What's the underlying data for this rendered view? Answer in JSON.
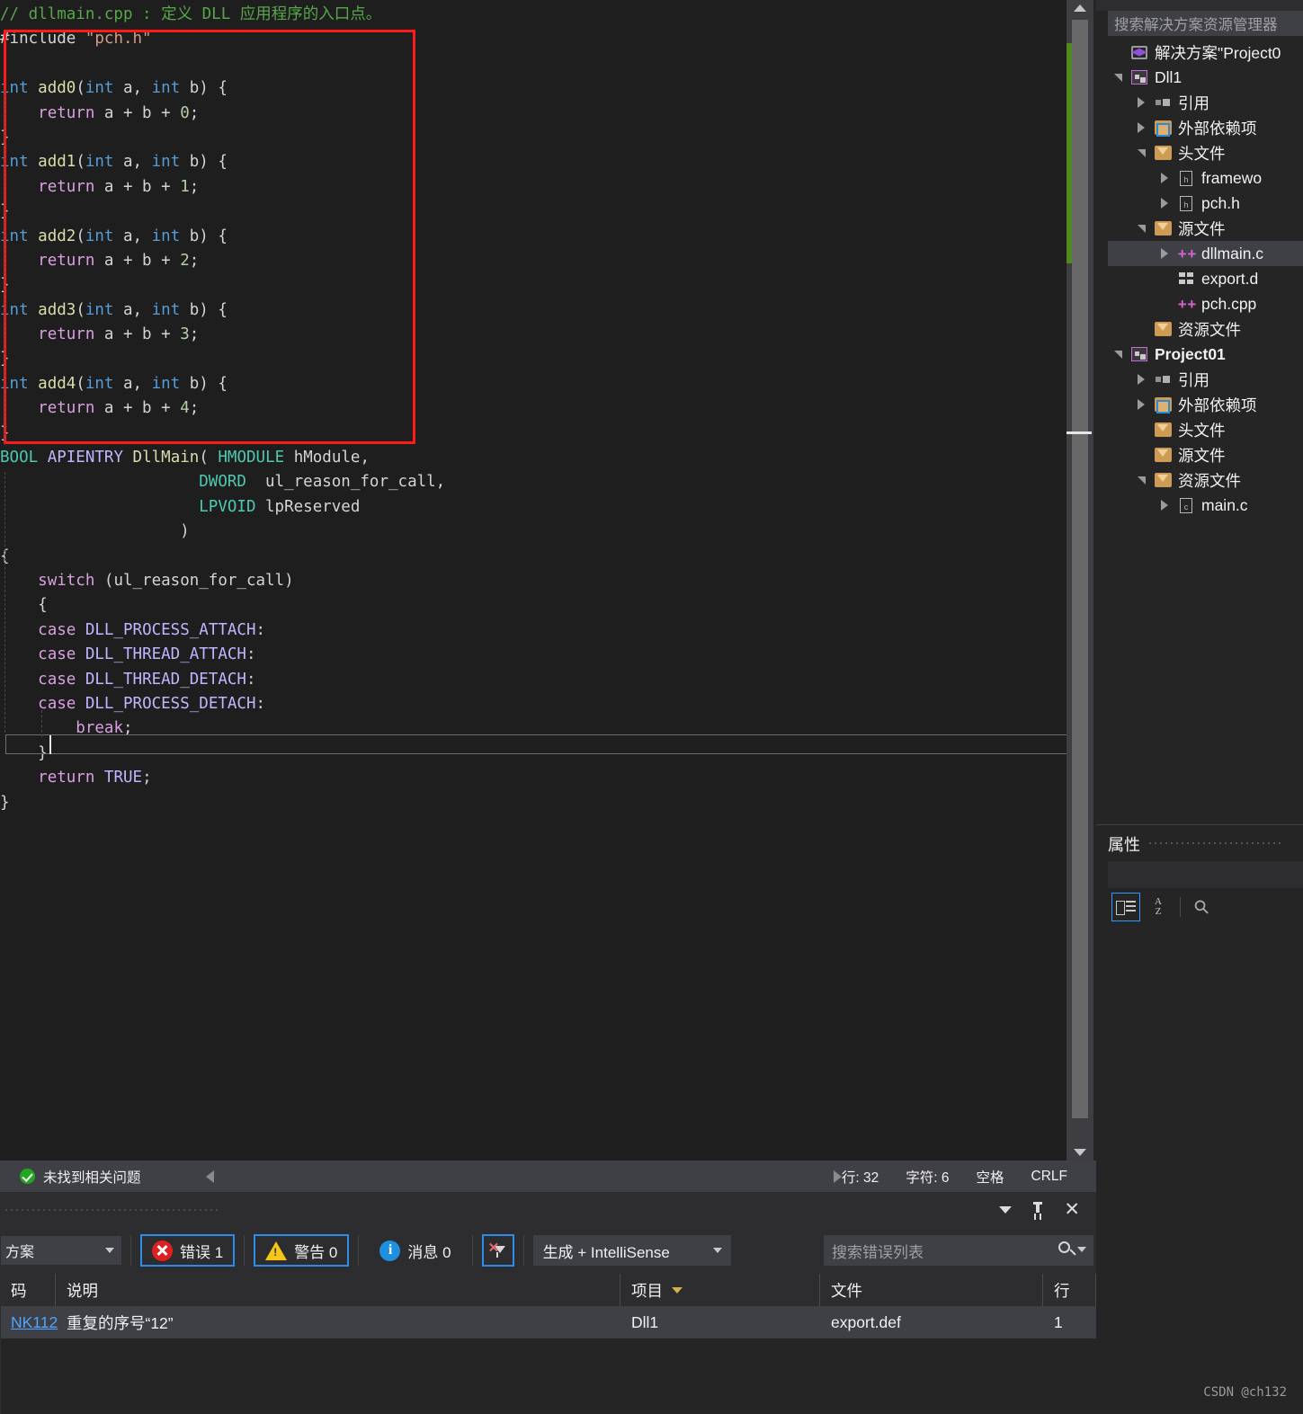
{
  "editor": {
    "filename": "dllmain.cpp",
    "code_lines": [
      {
        "tokens": [
          {
            "t": "// dllmain.cpp : 定义 DLL 应用程序的入口点。",
            "c": "cmt"
          }
        ]
      },
      {
        "tokens": [
          {
            "t": "#include",
            "c": "pp"
          },
          {
            "t": " ",
            "c": "pun"
          },
          {
            "t": "\"pch.h\"",
            "c": "str"
          }
        ]
      },
      {
        "tokens": []
      },
      {
        "tokens": [
          {
            "t": "int",
            "c": "kw"
          },
          {
            "t": " ",
            "c": "pun"
          },
          {
            "t": "add0",
            "c": "fn"
          },
          {
            "t": "(",
            "c": "pun"
          },
          {
            "t": "int",
            "c": "kw"
          },
          {
            "t": " a, ",
            "c": "id"
          },
          {
            "t": "int",
            "c": "kw"
          },
          {
            "t": " b) {",
            "c": "id"
          }
        ]
      },
      {
        "tokens": [
          {
            "t": "    ",
            "c": "pun"
          },
          {
            "t": "return",
            "c": "kwp"
          },
          {
            "t": " a + b + ",
            "c": "id"
          },
          {
            "t": "0",
            "c": "num"
          },
          {
            "t": ";",
            "c": "id"
          }
        ]
      },
      {
        "tokens": [
          {
            "t": "}",
            "c": "id"
          }
        ]
      },
      {
        "tokens": [
          {
            "t": "int",
            "c": "kw"
          },
          {
            "t": " ",
            "c": "pun"
          },
          {
            "t": "add1",
            "c": "fn"
          },
          {
            "t": "(",
            "c": "pun"
          },
          {
            "t": "int",
            "c": "kw"
          },
          {
            "t": " a, ",
            "c": "id"
          },
          {
            "t": "int",
            "c": "kw"
          },
          {
            "t": " b) {",
            "c": "id"
          }
        ]
      },
      {
        "tokens": [
          {
            "t": "    ",
            "c": "pun"
          },
          {
            "t": "return",
            "c": "kwp"
          },
          {
            "t": " a + b + ",
            "c": "id"
          },
          {
            "t": "1",
            "c": "num"
          },
          {
            "t": ";",
            "c": "id"
          }
        ]
      },
      {
        "tokens": [
          {
            "t": "}",
            "c": "id"
          }
        ]
      },
      {
        "tokens": [
          {
            "t": "int",
            "c": "kw"
          },
          {
            "t": " ",
            "c": "pun"
          },
          {
            "t": "add2",
            "c": "fn"
          },
          {
            "t": "(",
            "c": "pun"
          },
          {
            "t": "int",
            "c": "kw"
          },
          {
            "t": " a, ",
            "c": "id"
          },
          {
            "t": "int",
            "c": "kw"
          },
          {
            "t": " b) {",
            "c": "id"
          }
        ]
      },
      {
        "tokens": [
          {
            "t": "    ",
            "c": "pun"
          },
          {
            "t": "return",
            "c": "kwp"
          },
          {
            "t": " a + b + ",
            "c": "id"
          },
          {
            "t": "2",
            "c": "num"
          },
          {
            "t": ";",
            "c": "id"
          }
        ]
      },
      {
        "tokens": [
          {
            "t": "}",
            "c": "id"
          }
        ]
      },
      {
        "tokens": [
          {
            "t": "int",
            "c": "kw"
          },
          {
            "t": " ",
            "c": "pun"
          },
          {
            "t": "add3",
            "c": "fn"
          },
          {
            "t": "(",
            "c": "pun"
          },
          {
            "t": "int",
            "c": "kw"
          },
          {
            "t": " a, ",
            "c": "id"
          },
          {
            "t": "int",
            "c": "kw"
          },
          {
            "t": " b) {",
            "c": "id"
          }
        ]
      },
      {
        "tokens": [
          {
            "t": "    ",
            "c": "pun"
          },
          {
            "t": "return",
            "c": "kwp"
          },
          {
            "t": " a + b + ",
            "c": "id"
          },
          {
            "t": "3",
            "c": "num"
          },
          {
            "t": ";",
            "c": "id"
          }
        ]
      },
      {
        "tokens": [
          {
            "t": "}",
            "c": "id"
          }
        ]
      },
      {
        "tokens": [
          {
            "t": "int",
            "c": "kw"
          },
          {
            "t": " ",
            "c": "pun"
          },
          {
            "t": "add4",
            "c": "fn"
          },
          {
            "t": "(",
            "c": "pun"
          },
          {
            "t": "int",
            "c": "kw"
          },
          {
            "t": " a, ",
            "c": "id"
          },
          {
            "t": "int",
            "c": "kw"
          },
          {
            "t": " b) {",
            "c": "id"
          }
        ]
      },
      {
        "tokens": [
          {
            "t": "    ",
            "c": "pun"
          },
          {
            "t": "return",
            "c": "kwp"
          },
          {
            "t": " a + b + ",
            "c": "id"
          },
          {
            "t": "4",
            "c": "num"
          },
          {
            "t": ";",
            "c": "id"
          }
        ]
      },
      {
        "tokens": [
          {
            "t": "}",
            "c": "id"
          }
        ]
      },
      {
        "tokens": [
          {
            "t": "BOOL",
            "c": "typ"
          },
          {
            "t": " ",
            "c": "pun"
          },
          {
            "t": "APIENTRY",
            "c": "mac"
          },
          {
            "t": " ",
            "c": "pun"
          },
          {
            "t": "DllMain",
            "c": "fn"
          },
          {
            "t": "( ",
            "c": "pun"
          },
          {
            "t": "HMODULE",
            "c": "typ"
          },
          {
            "t": " hModule,",
            "c": "id"
          }
        ]
      },
      {
        "tokens": [
          {
            "t": "                     ",
            "c": "pun"
          },
          {
            "t": "DWORD",
            "c": "typ"
          },
          {
            "t": "  ul_reason_for_call,",
            "c": "id"
          }
        ]
      },
      {
        "tokens": [
          {
            "t": "                     ",
            "c": "pun"
          },
          {
            "t": "LPVOID",
            "c": "typ"
          },
          {
            "t": " lpReserved",
            "c": "id"
          }
        ]
      },
      {
        "tokens": [
          {
            "t": "                   )",
            "c": "id"
          }
        ]
      },
      {
        "tokens": [
          {
            "t": "{",
            "c": "id"
          }
        ]
      },
      {
        "tokens": [
          {
            "t": "    ",
            "c": "pun"
          },
          {
            "t": "switch",
            "c": "kwp"
          },
          {
            "t": " (ul_reason_for_call)",
            "c": "id"
          }
        ]
      },
      {
        "tokens": [
          {
            "t": "    {",
            "c": "id"
          }
        ]
      },
      {
        "tokens": [
          {
            "t": "    ",
            "c": "pun"
          },
          {
            "t": "case",
            "c": "kwp"
          },
          {
            "t": " ",
            "c": "pun"
          },
          {
            "t": "DLL_PROCESS_ATTACH",
            "c": "mac"
          },
          {
            "t": ":",
            "c": "id"
          }
        ]
      },
      {
        "tokens": [
          {
            "t": "    ",
            "c": "pun"
          },
          {
            "t": "case",
            "c": "kwp"
          },
          {
            "t": " ",
            "c": "pun"
          },
          {
            "t": "DLL_THREAD_ATTACH",
            "c": "mac"
          },
          {
            "t": ":",
            "c": "id"
          }
        ]
      },
      {
        "tokens": [
          {
            "t": "    ",
            "c": "pun"
          },
          {
            "t": "case",
            "c": "kwp"
          },
          {
            "t": " ",
            "c": "pun"
          },
          {
            "t": "DLL_THREAD_DETACH",
            "c": "mac"
          },
          {
            "t": ":",
            "c": "id"
          }
        ]
      },
      {
        "tokens": [
          {
            "t": "    ",
            "c": "pun"
          },
          {
            "t": "case",
            "c": "kwp"
          },
          {
            "t": " ",
            "c": "pun"
          },
          {
            "t": "DLL_PROCESS_DETACH",
            "c": "mac"
          },
          {
            "t": ":",
            "c": "id"
          }
        ]
      },
      {
        "tokens": [
          {
            "t": "        ",
            "c": "pun"
          },
          {
            "t": "break",
            "c": "kwp"
          },
          {
            "t": ";",
            "c": "id"
          }
        ]
      },
      {
        "tokens": [
          {
            "t": "    }",
            "c": "id"
          }
        ]
      },
      {
        "tokens": [
          {
            "t": "    ",
            "c": "pun"
          },
          {
            "t": "return",
            "c": "kwp"
          },
          {
            "t": " ",
            "c": "pun"
          },
          {
            "t": "TRUE",
            "c": "mac"
          },
          {
            "t": ";",
            "c": "id"
          }
        ]
      },
      {
        "tokens": [
          {
            "t": "}",
            "c": "id"
          }
        ]
      }
    ]
  },
  "status_bar": {
    "message": "未找到相关问题",
    "line_label": "行: 32",
    "char_label": "字符: 6",
    "indent_label": "空格",
    "eol_label": "CRLF"
  },
  "solution_explorer": {
    "search_placeholder": "搜索解决方案资源管理器",
    "tree": [
      {
        "label": "解决方案\"Project0",
        "icon": "solution-icon",
        "depth": 0,
        "expander": "none",
        "bold": false,
        "selected": false
      },
      {
        "label": "Dll1",
        "icon": "project-icon",
        "depth": 0,
        "expander": "down",
        "bold": false,
        "selected": false
      },
      {
        "label": "引用",
        "icon": "references-icon",
        "depth": 1,
        "expander": "right",
        "bold": false,
        "selected": false
      },
      {
        "label": "外部依赖项",
        "icon": "external-deps-icon",
        "depth": 1,
        "expander": "right",
        "bold": false,
        "selected": false
      },
      {
        "label": "头文件",
        "icon": "filter-folder-icon",
        "depth": 1,
        "expander": "down",
        "bold": false,
        "selected": false
      },
      {
        "label": "framewo",
        "icon": "header-file-icon",
        "depth": 2,
        "expander": "right",
        "bold": false,
        "selected": false
      },
      {
        "label": "pch.h",
        "icon": "header-file-icon",
        "depth": 2,
        "expander": "right",
        "bold": false,
        "selected": false
      },
      {
        "label": "源文件",
        "icon": "filter-folder-icon",
        "depth": 1,
        "expander": "down",
        "bold": false,
        "selected": false
      },
      {
        "label": "dllmain.c",
        "icon": "cpp-file-icon",
        "depth": 2,
        "expander": "right",
        "bold": false,
        "selected": true
      },
      {
        "label": "export.d",
        "icon": "def-file-icon",
        "depth": 2,
        "expander": "none",
        "bold": false,
        "selected": false
      },
      {
        "label": "pch.cpp",
        "icon": "cpp-file-icon",
        "depth": 2,
        "expander": "none",
        "bold": false,
        "selected": false
      },
      {
        "label": "资源文件",
        "icon": "filter-folder-icon",
        "depth": 1,
        "expander": "none",
        "bold": false,
        "selected": false
      },
      {
        "label": "Project01",
        "icon": "project-icon",
        "depth": 0,
        "expander": "down",
        "bold": true,
        "selected": false
      },
      {
        "label": "引用",
        "icon": "references-icon",
        "depth": 1,
        "expander": "right",
        "bold": false,
        "selected": false
      },
      {
        "label": "外部依赖项",
        "icon": "external-deps-icon",
        "depth": 1,
        "expander": "right",
        "bold": false,
        "selected": false
      },
      {
        "label": "头文件",
        "icon": "filter-folder-icon",
        "depth": 1,
        "expander": "none",
        "bold": false,
        "selected": false
      },
      {
        "label": "源文件",
        "icon": "filter-folder-icon",
        "depth": 1,
        "expander": "none",
        "bold": false,
        "selected": false
      },
      {
        "label": "资源文件",
        "icon": "filter-folder-icon",
        "depth": 1,
        "expander": "down",
        "bold": false,
        "selected": false
      },
      {
        "label": "main.c",
        "icon": "c-file-icon",
        "depth": 2,
        "expander": "right",
        "bold": false,
        "selected": false
      }
    ]
  },
  "properties_panel": {
    "title": "属性",
    "buttons": [
      "categorized-icon",
      "alphabetical-icon",
      "property-pages-icon"
    ]
  },
  "error_list": {
    "scope_value": "方案",
    "errors_label": "错误 1",
    "warnings_label": "警告 0",
    "messages_label": "消息 0",
    "build_filter_value": "生成 + IntelliSense",
    "search_placeholder": "搜索错误列表",
    "columns": [
      "码",
      "说明",
      "项目",
      "文件",
      "行"
    ],
    "rows": [
      {
        "code": "NK112",
        "description": "重复的序号“12”",
        "project": "Dll1",
        "file": "export.def",
        "line": "1"
      }
    ]
  },
  "watermark": "CSDN @ch132",
  "colors": {
    "accent_blue": "#2d8ceb",
    "error_red": "#e02020",
    "warning_yellow": "#f5c518",
    "info_blue": "#1f8fe0",
    "annotation_red": "#ff1a1a",
    "change_marker_green": "#4e8a1e"
  }
}
